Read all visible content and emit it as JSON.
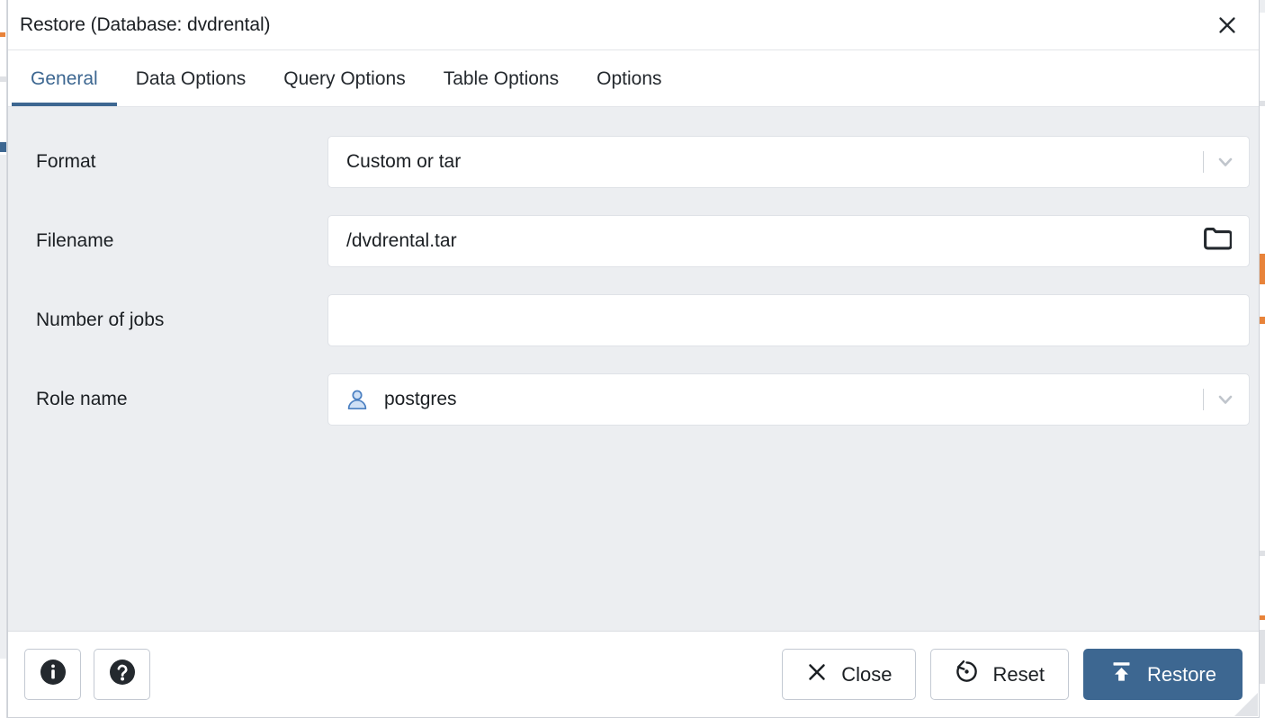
{
  "window": {
    "title": "Restore (Database: dvdrental)",
    "close_icon": "close-icon"
  },
  "tabs": [
    {
      "label": "General",
      "active": true
    },
    {
      "label": "Data Options",
      "active": false
    },
    {
      "label": "Query Options",
      "active": false
    },
    {
      "label": "Table Options",
      "active": false
    },
    {
      "label": "Options",
      "active": false
    }
  ],
  "form": {
    "fields": [
      {
        "label": "Format",
        "type": "select",
        "value": "Custom or tar",
        "placeholder": "",
        "icon": "chevron-down-icon"
      },
      {
        "label": "Filename",
        "type": "file",
        "value": "/dvdrental.tar",
        "placeholder": "",
        "icon": "folder-icon"
      },
      {
        "label": "Number of jobs",
        "type": "text",
        "value": "",
        "placeholder": "",
        "icon": ""
      },
      {
        "label": "Role name",
        "type": "select",
        "value": "postgres",
        "placeholder": "",
        "icon": "chevron-down-icon",
        "leading_icon": "user-icon"
      }
    ]
  },
  "footer": {
    "info_label": "Info",
    "help_label": "Help",
    "close_label": "Close",
    "reset_label": "Reset",
    "restore_label": "Restore"
  },
  "colors": {
    "accent": "#3d6791",
    "body_bg": "#eceef1",
    "surface": "#ffffff",
    "text": "#1b1f23",
    "border": "#dfe2e7"
  }
}
